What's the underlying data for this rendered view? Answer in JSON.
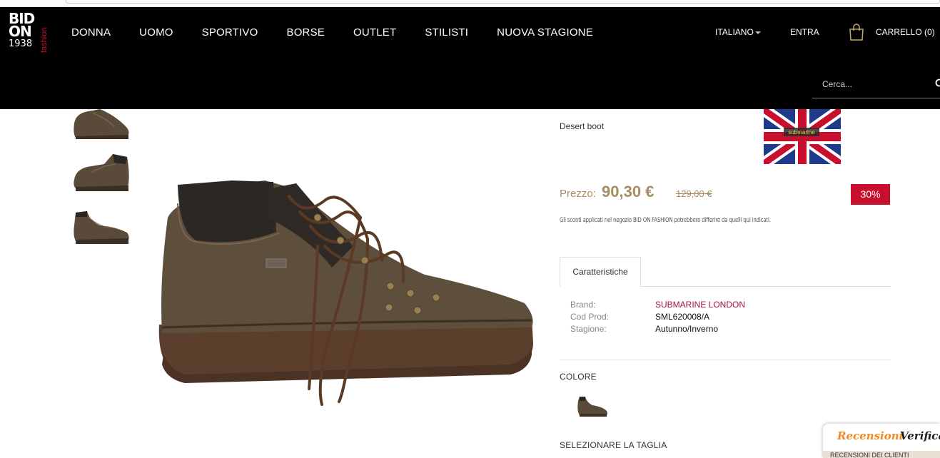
{
  "logo": {
    "line1": "BID",
    "line2": "ON",
    "line3": "1938",
    "vertical": "fashion"
  },
  "nav": {
    "items": [
      "DONNA",
      "UOMO",
      "SPORTIVO",
      "BORSE",
      "OUTLET",
      "STILISTI",
      "NUOVA STAGIONE"
    ]
  },
  "header": {
    "language": "ITALIANO",
    "login": "ENTRA",
    "cart": "CARRELLO (0)"
  },
  "search": {
    "placeholder": "Cerca..."
  },
  "product": {
    "subtitle": "Desert boot",
    "brand_logo_text": "submarine",
    "price_label": "Prezzo:",
    "price": "90,30 €",
    "old_price": "129,00 €",
    "discount": "30%",
    "note": "Gli sconti applicati nel negozio BID ON FASHION potrebbero differire da quelli qui indicati.",
    "tab": "Caratteristiche",
    "specs": [
      {
        "key": "Brand:",
        "value": "SUBMARINE LONDON"
      },
      {
        "key": "Cod Prod:",
        "value": "SML620008/A"
      },
      {
        "key": "Stagione:",
        "value": "Autunno/Inverno"
      }
    ],
    "color_label": "COLORE",
    "size_label": "SELEZIONARE LA TAGLIA"
  },
  "reviews_widget": {
    "title": "Recensioni",
    "title2": "Verifica",
    "band": "RECENSIONI DEI CLIENTI"
  },
  "colors": {
    "accent_red": "#c8102e",
    "price_gold": "#a88c64",
    "link_red": "#a5123d",
    "header_bg": "#000000"
  }
}
